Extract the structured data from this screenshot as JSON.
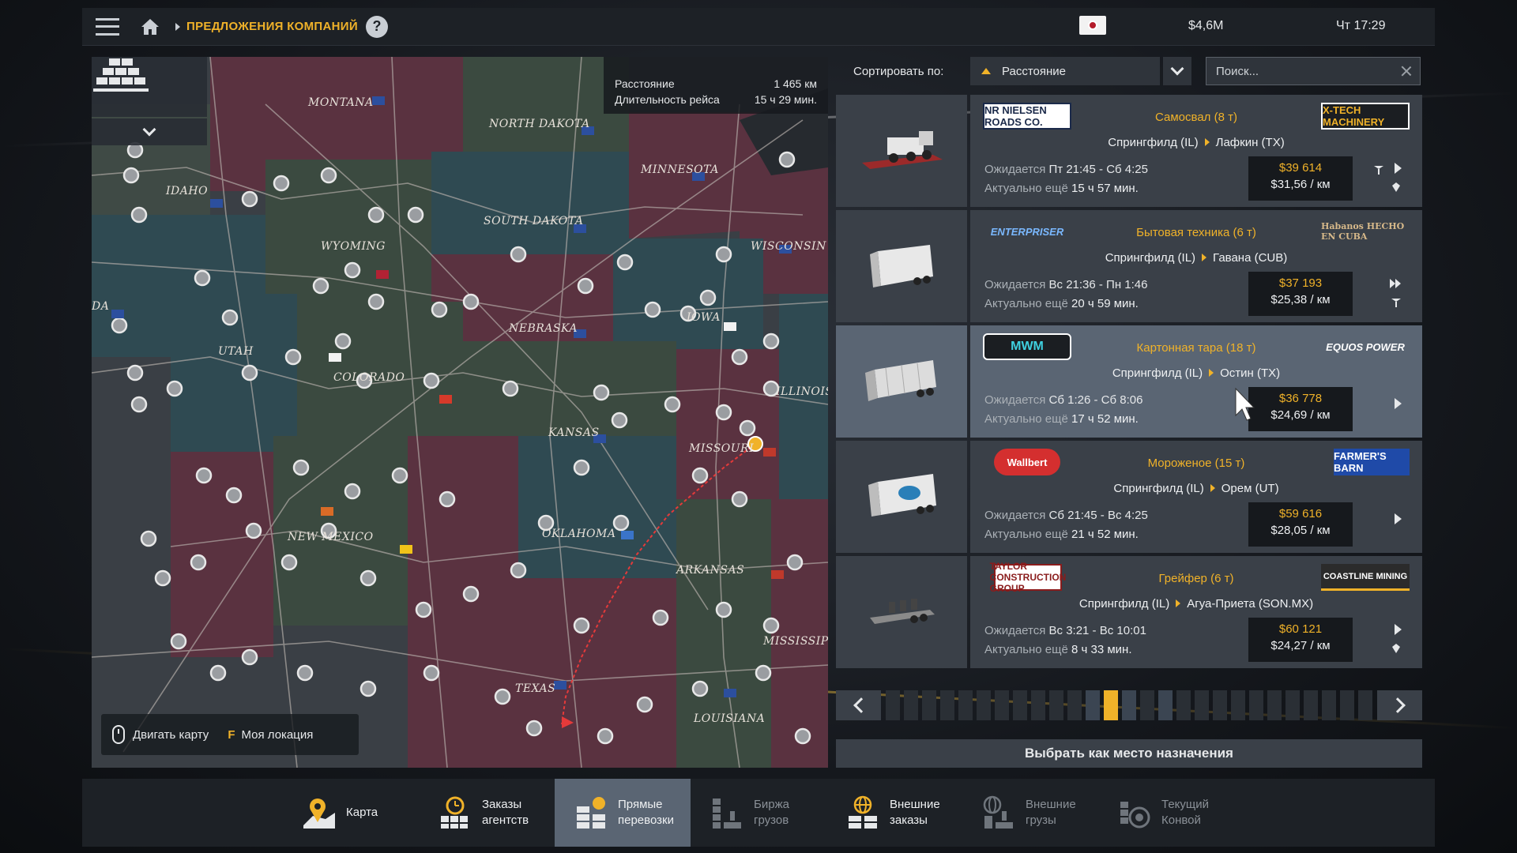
{
  "header": {
    "breadcrumb": "ПРЕДЛОЖЕНИЯ КОМПАНИЙ",
    "help": "?",
    "money": "$4,6M",
    "clock": "Чт 17:29"
  },
  "map": {
    "stats": {
      "distance_label": "Расстояние",
      "distance_value": "1 465 км",
      "duration_label": "Длительность рейса",
      "duration_value": "15 ч 29 мин."
    },
    "hints": {
      "move_label": "Двигать карту",
      "key_f": "F",
      "location_label": "Моя локация"
    },
    "states": [
      "MONTANA",
      "NORTH DAKOTA",
      "MINNESOTA",
      "IDAHO",
      "SOUTH DAKOTA",
      "WYOMING",
      "WISCONSIN",
      "NEBRASKA",
      "IOWA",
      "UTAH",
      "COLORADO",
      "KANSAS",
      "MISSOURI",
      "ILLINOIS",
      "NEW MEXICO",
      "OKLAHOMA",
      "ARKANSAS",
      "TEXAS",
      "MISSISSIPPI",
      "LOUISIANA",
      "DA"
    ]
  },
  "sort": {
    "label": "Сортировать по:",
    "value": "Расстояние",
    "search_placeholder": "Поиск..."
  },
  "jobs": [
    {
      "logo_left": "NR NIELSEN ROADS CO.",
      "logo_right": "X-TECH MACHINERY",
      "cargo": "Самосвал (8 т)",
      "from": "Спрингфилд (IL)",
      "to": "Лафкин (TX)",
      "expect_label": "Ожидается",
      "expect_value": "Пт 21:45 - Сб 4:25",
      "remain_label": "Актуально ещё",
      "remain_value": "15 ч 57 мин.",
      "price": "$39 614",
      "per_km": "$31,56 / км"
    },
    {
      "logo_left": "ENTERPRISER",
      "logo_right": "Habanos HECHO EN CUBA",
      "cargo": "Бытовая техника (6 т)",
      "from": "Спрингфилд (IL)",
      "to": "Гавана (CUB)",
      "expect_label": "Ожидается",
      "expect_value": "Вс 21:36 - Пн 1:46",
      "remain_label": "Актуально ещё",
      "remain_value": "20 ч 59 мин.",
      "price": "$37 193",
      "per_km": "$25,38 / км"
    },
    {
      "logo_left": "MWM",
      "logo_right": "EQUOS POWER",
      "cargo": "Картонная тара (18 т)",
      "from": "Спрингфилд (IL)",
      "to": "Остин (TX)",
      "expect_label": "Ожидается",
      "expect_value": "Сб 1:26 - Сб 8:06",
      "remain_label": "Актуально ещё",
      "remain_value": "17 ч 52 мин.",
      "price": "$36 778",
      "per_km": "$24,69 / км"
    },
    {
      "logo_left": "Wallbert",
      "logo_right": "FARMER'S BARN",
      "cargo": "Мороженое (15 т)",
      "from": "Спрингфилд (IL)",
      "to": "Орем (UT)",
      "expect_label": "Ожидается",
      "expect_value": "Сб 21:45 - Вс 4:25",
      "remain_label": "Актуально ещё",
      "remain_value": "21 ч 52 мин.",
      "price": "$59 616",
      "per_km": "$28,05 / км"
    },
    {
      "logo_left": "TAYLOR CONSTRUCTION GROUP",
      "logo_right": "COASTLINE MINING",
      "cargo": "Грейфер (6 т)",
      "from": "Спрингфилд (IL)",
      "to": "Агуа-Приета (SON.MX)",
      "expect_label": "Ожидается",
      "expect_value": "Вс 3:21 - Вс 10:01",
      "remain_label": "Актуально ещё",
      "remain_value": "8 ч 33 мин.",
      "price": "$60 121",
      "per_km": "$24,27 / км"
    }
  ],
  "pager": {
    "pages": 27,
    "current": 12
  },
  "select_button": "Выбрать как место назначения",
  "tabs": [
    {
      "label": "Карта",
      "icon": "map-icon"
    },
    {
      "label": "Заказы\nагентств",
      "icon": "agency-orders-icon"
    },
    {
      "label": "Прямые\nперевозки",
      "icon": "direct-transport-icon"
    },
    {
      "label": "Биржа\nгрузов",
      "icon": "freight-market-icon"
    },
    {
      "label": "Внешние\nзаказы",
      "icon": "external-orders-icon"
    },
    {
      "label": "Внешние\nгрузы",
      "icon": "external-cargo-icon"
    },
    {
      "label": "Текущий\nКонвой",
      "icon": "convoy-icon"
    }
  ],
  "colors": {
    "accent": "#f0b229",
    "panel": "#3a4048",
    "selected": "#5a6573",
    "bar": "#1d2126"
  }
}
